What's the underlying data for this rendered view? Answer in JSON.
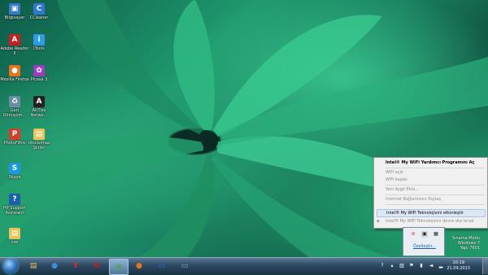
{
  "desktop": {
    "icons": [
      {
        "label": "Bilgisayar",
        "icon": "computer-icon",
        "color": "#3a78c8",
        "glyph": "▣"
      },
      {
        "label": "CCleaner",
        "icon": "ccleaner-icon",
        "color": "#2f7ad1",
        "glyph": "C"
      },
      {
        "label": "Adobe Reader X",
        "icon": "adobe-reader-icon",
        "color": "#c81e1e",
        "glyph": "A"
      },
      {
        "label": "iTools",
        "icon": "itools-icon",
        "color": "#2d9be6",
        "glyph": "i"
      },
      {
        "label": "Mozilla Firefox",
        "icon": "firefox-icon",
        "color": "#e8731c",
        "glyph": "●"
      },
      {
        "label": "Picasa 3",
        "icon": "picasa-icon",
        "color": "#9b3fc2",
        "glyph": "✿"
      },
      {
        "label": "Geri Dönüşüm...",
        "icon": "recycle-bin-icon",
        "color": "#6e8ca3",
        "glyph": "♻"
      },
      {
        "label": "AirTies Netwo...",
        "icon": "airties-icon",
        "color": "#222222",
        "glyph": "A"
      },
      {
        "label": "PhotoFiltre",
        "icon": "photofiltre-icon",
        "color": "#d43f2a",
        "glyph": "P"
      },
      {
        "label": "Unutulmaz Şiirler",
        "icon": "folder-icon",
        "color": "#e8c45a",
        "glyph": "▤"
      },
      {
        "label": "Skype",
        "icon": "skype-icon",
        "color": "#1a9be0",
        "glyph": "S"
      },
      {
        "label": "HP Support Assistant",
        "icon": "hp-support-icon",
        "color": "#1c5fa8",
        "glyph": "?"
      },
      {
        "label": "oiei",
        "icon": "folder-icon",
        "color": "#e8c45a",
        "glyph": "▤"
      }
    ]
  },
  "context_menu": {
    "items": [
      {
        "label": "Intel® My WiFi Yardımcı Programını Aç",
        "style": "bold"
      },
      {
        "label": "WiFi açık",
        "style": "disabled"
      },
      {
        "label": "WiFi kapalı",
        "style": "disabled"
      },
      {
        "label": "Yeni Aygıt Ekle...",
        "style": "disabled"
      },
      {
        "label": "Internet Bağlantısını Paylaş",
        "style": "disabled"
      },
      {
        "label": "Intel® My WiFi Teknolojisini etkinleştir",
        "style": "hover"
      },
      {
        "label": "Intel® My WiFi Teknolojisini devre dışı bırak",
        "style": "disabled"
      }
    ]
  },
  "tray_flyout": {
    "customize_label": "Özelleştir..."
  },
  "taskbar": {
    "apps": [
      {
        "name": "explorer",
        "icon": "folder-icon",
        "glyph": "▤",
        "color": "#e8c45a"
      },
      {
        "name": "media",
        "icon": "media-player-icon",
        "glyph": "●",
        "color": "#3c8fd8"
      },
      {
        "name": "yandex",
        "icon": "yandex-icon",
        "glyph": "Y",
        "color": "#e52620"
      },
      {
        "name": "opera",
        "icon": "opera-icon",
        "glyph": "O",
        "color": "#d4151c"
      },
      {
        "name": "chrome",
        "icon": "chrome-icon",
        "glyph": "◉",
        "color": "#4aa84b"
      },
      {
        "name": "firefox",
        "icon": "firefox-icon",
        "glyph": "●",
        "color": "#e8731c"
      },
      {
        "name": "word",
        "icon": "word-icon",
        "glyph": "W",
        "color": "#2b5797"
      },
      {
        "name": "window",
        "icon": "window-icon",
        "glyph": "▭",
        "color": "#7fb8e8"
      }
    ],
    "clock_time": "10:19",
    "clock_date": "21.09.2013"
  },
  "watermark": {
    "line1": "Sınama Modu",
    "line2": "Windows 7",
    "line3": "Yapı 7601"
  }
}
